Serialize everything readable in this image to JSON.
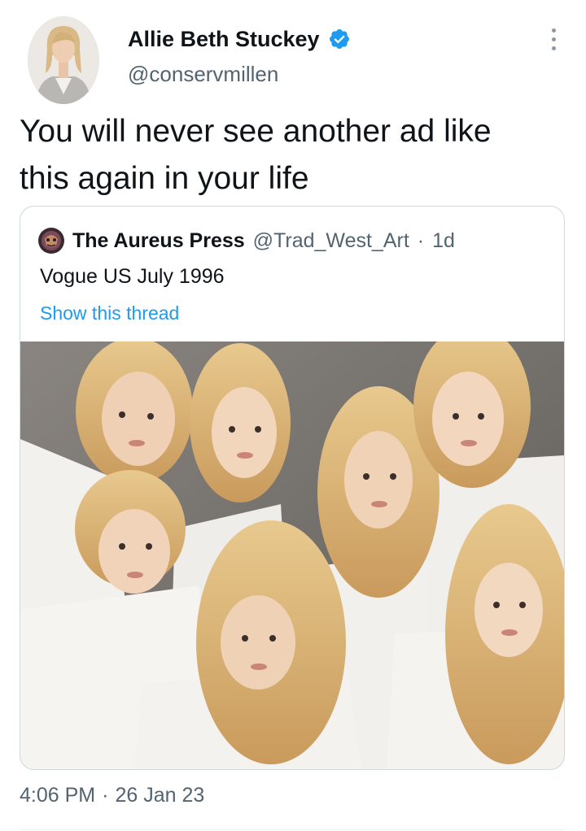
{
  "author": {
    "name": "Allie Beth Stuckey",
    "handle": "@conservmillen",
    "verified": true,
    "avatar_icon": "profile-photo"
  },
  "tweet": {
    "text_line1": "You will never see another ad like",
    "text_line2": "this again in your life"
  },
  "quoted": {
    "name": "The Aureus Press",
    "handle": "@Trad_West_Art",
    "separator": "·",
    "time": "1d",
    "text": "Vogue US July 1996",
    "show_thread": "Show this thread",
    "image_icon": "group-photo"
  },
  "meta": {
    "time": "4:06 PM",
    "separator": "·",
    "date": "26 Jan 23"
  },
  "colors": {
    "verified": "#1d9bf0",
    "link": "#1d9bf0",
    "secondary_text": "#536471",
    "border": "#cfd9de"
  }
}
